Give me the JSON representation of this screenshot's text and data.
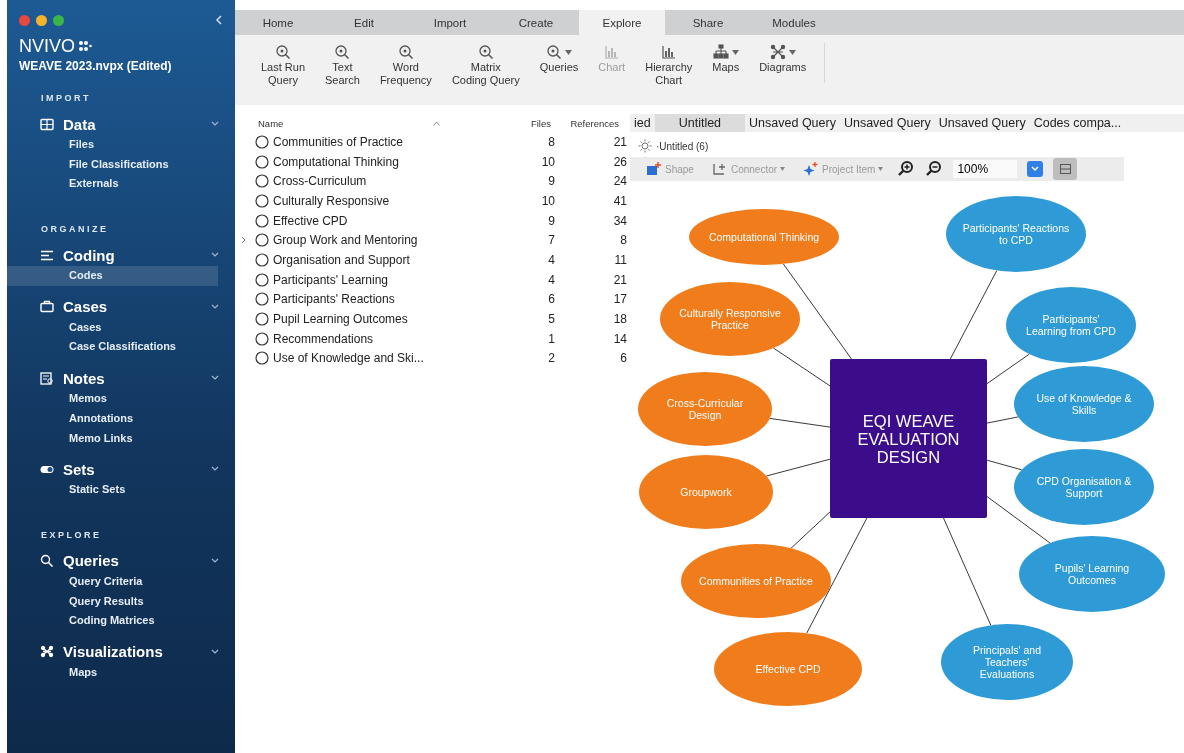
{
  "sidebar": {
    "project": "WEAVE 2023.nvpx (Edited)",
    "logo": "NVIVO",
    "sections": [
      {
        "title": "IMPORT",
        "groups": [
          {
            "label": "Data",
            "expanded": true,
            "items": [
              {
                "label": "Files",
                "selected": false
              },
              {
                "label": "File Classifications",
                "selected": false
              },
              {
                "label": "Externals",
                "selected": false
              }
            ]
          }
        ]
      },
      {
        "title": "ORGANIZE",
        "groups": [
          {
            "label": "Coding",
            "expanded": true,
            "items": [
              {
                "label": "Codes",
                "selected": true
              }
            ]
          },
          {
            "label": "Cases",
            "expanded": true,
            "items": [
              {
                "label": "Cases",
                "selected": false
              },
              {
                "label": "Case Classifications",
                "selected": false
              }
            ]
          },
          {
            "label": "Notes",
            "expanded": true,
            "items": [
              {
                "label": "Memos",
                "selected": false
              },
              {
                "label": "Annotations",
                "selected": false
              },
              {
                "label": "Memo Links",
                "selected": false
              }
            ]
          },
          {
            "label": "Sets",
            "expanded": true,
            "items": [
              {
                "label": "Static Sets",
                "selected": false
              }
            ]
          }
        ]
      },
      {
        "title": "EXPLORE",
        "groups": [
          {
            "label": "Queries",
            "expanded": true,
            "items": [
              {
                "label": "Query Criteria",
                "selected": false
              },
              {
                "label": "Query Results",
                "selected": false
              },
              {
                "label": "Coding Matrices",
                "selected": false
              }
            ]
          },
          {
            "label": "Visualizations",
            "expanded": true,
            "items": [
              {
                "label": "Maps",
                "selected": false
              }
            ]
          }
        ]
      }
    ]
  },
  "ribbon_tabs": [
    {
      "label": "Home",
      "selected": false
    },
    {
      "label": "Edit",
      "selected": false
    },
    {
      "label": "Import",
      "selected": false
    },
    {
      "label": "Create",
      "selected": false
    },
    {
      "label": "Explore",
      "selected": true
    },
    {
      "label": "Share",
      "selected": false
    },
    {
      "label": "Modules",
      "selected": false
    }
  ],
  "ribbon_buttons": [
    {
      "label": "Last Run Query",
      "disabled": false,
      "dropdown": false
    },
    {
      "label": "Text Search",
      "disabled": false,
      "dropdown": false
    },
    {
      "label": "Word Frequency",
      "disabled": false,
      "dropdown": false
    },
    {
      "label": "Matrix Coding Query",
      "disabled": false,
      "dropdown": false
    },
    {
      "label": "Queries",
      "disabled": false,
      "dropdown": true
    },
    {
      "label": "Chart",
      "disabled": true,
      "dropdown": false
    },
    {
      "label": "Hierarchy Chart",
      "disabled": false,
      "dropdown": false
    },
    {
      "label": "Maps",
      "disabled": false,
      "dropdown": true
    },
    {
      "label": "Diagrams",
      "disabled": false,
      "dropdown": true
    }
  ],
  "codes_table": {
    "columns": [
      "Name",
      "Files",
      "References"
    ],
    "rows": [
      {
        "name": "Communities of Practice",
        "files": "8",
        "references": "21",
        "expandable": false
      },
      {
        "name": "Computational Thinking",
        "files": "10",
        "references": "26",
        "expandable": false
      },
      {
        "name": "Cross-Curriculum",
        "files": "9",
        "references": "24",
        "expandable": false
      },
      {
        "name": "Culturally Responsive",
        "files": "10",
        "references": "41",
        "expandable": false
      },
      {
        "name": "Effective CPD",
        "files": "9",
        "references": "34",
        "expandable": false
      },
      {
        "name": "Group Work and Mentoring",
        "files": "7",
        "references": "8",
        "expandable": true
      },
      {
        "name": "Organisation and Support",
        "files": "4",
        "references": "11",
        "expandable": false
      },
      {
        "name": "Participants' Learning",
        "files": "4",
        "references": "21",
        "expandable": false
      },
      {
        "name": "Participants' Reactions",
        "files": "6",
        "references": "17",
        "expandable": false
      },
      {
        "name": "Pupil Learning Outcomes",
        "files": "5",
        "references": "18",
        "expandable": false
      },
      {
        "name": "Recommendations",
        "files": "1",
        "references": "14",
        "expandable": false
      },
      {
        "name": "Use of Knowledge and Ski...",
        "files": "2",
        "references": "6",
        "expandable": false
      }
    ]
  },
  "document_tabs": [
    {
      "label": "ied",
      "selected": false
    },
    {
      "label": "Untitled",
      "selected": true
    },
    {
      "label": "Unsaved Query",
      "selected": false
    },
    {
      "label": "Unsaved Query",
      "selected": false
    },
    {
      "label": "Unsaved Query",
      "selected": false
    },
    {
      "label": "Codes compa...",
      "selected": false
    }
  ],
  "map_title": "·Untitled (6)",
  "map_toolbar": {
    "items": [
      {
        "label": "Shape",
        "disabled": true,
        "dropdown": false
      },
      {
        "label": "Connector",
        "disabled": true,
        "dropdown": true
      },
      {
        "label": "Project Item",
        "disabled": true,
        "dropdown": true
      }
    ],
    "zoom": "100%"
  },
  "mind_map": {
    "center": "EQI WEAVE EVALUATION DESIGN",
    "nodes": [
      {
        "label": "Computational Thinking",
        "color": "#f07c1b"
      },
      {
        "label": "Culturally Responsive Practice",
        "color": "#f07c1b"
      },
      {
        "label": "Cross-Curricular Design",
        "color": "#f07c1b"
      },
      {
        "label": "Groupwork",
        "color": "#f07c1b"
      },
      {
        "label": "Communities of Practice",
        "color": "#f07c1b"
      },
      {
        "label": "Effective CPD",
        "color": "#f07c1b"
      },
      {
        "label": "Participants' Reactions to CPD",
        "color": "#2f9bd6"
      },
      {
        "label": "Participants' Learning from CPD",
        "color": "#2f9bd6"
      },
      {
        "label": "Use of Knowledge & Skills",
        "color": "#2f9bd6"
      },
      {
        "label": "CPD Organisation & Support",
        "color": "#2f9bd6"
      },
      {
        "label": "Pupils' Learning Outcomes",
        "color": "#2f9bd6"
      },
      {
        "label": "Principals' and Teachers' Evaluations",
        "color": "#2f9bd6"
      }
    ]
  }
}
